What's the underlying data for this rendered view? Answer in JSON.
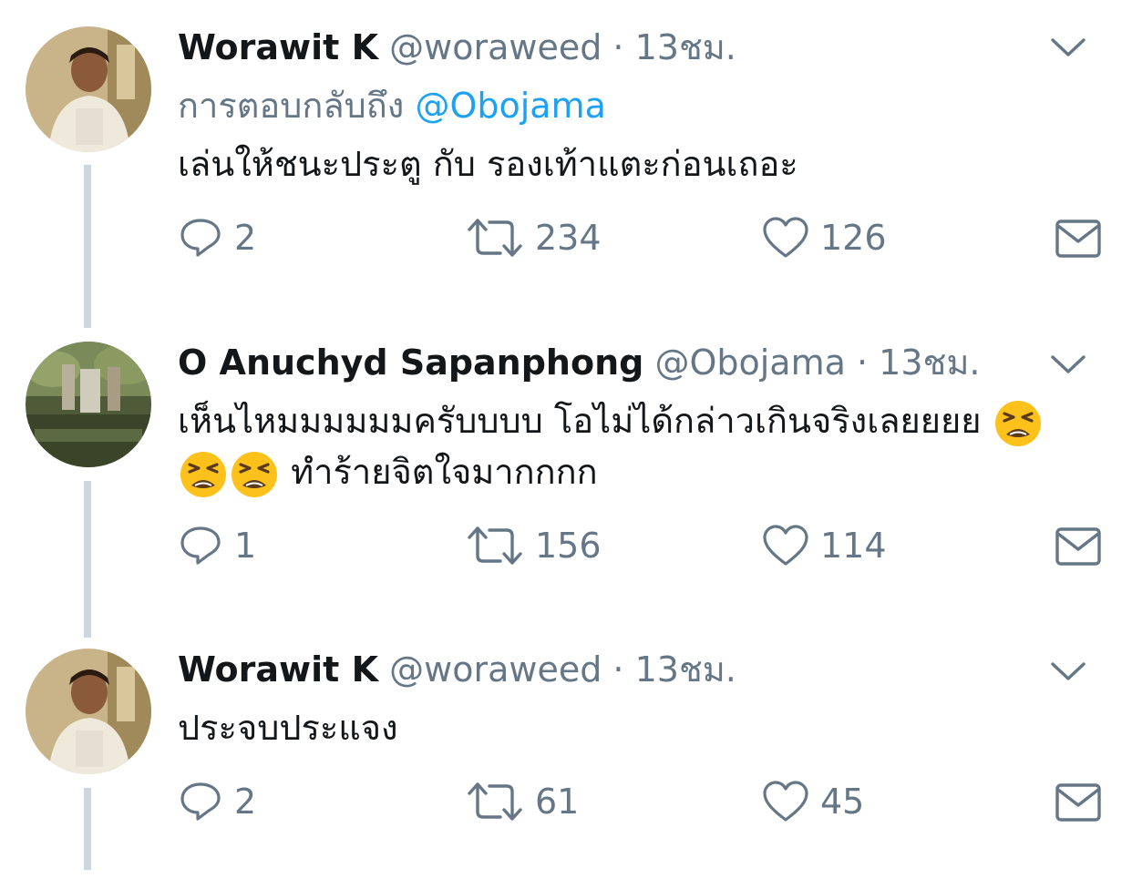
{
  "colors": {
    "text": "#14171a",
    "secondary": "#657786",
    "link": "#1da1f2",
    "thread_line": "#ccd6dd"
  },
  "tweets": [
    {
      "name": "Worawit K",
      "handle": "@woraweed",
      "separator": "·",
      "time": "13ชม.",
      "reply_prefix": "การตอบกลับถึง",
      "reply_to": "@Obojama",
      "text_lines": [
        "เล่นให้ชนะประตู กับ รองเท้าแตะก่อนเถอะ"
      ],
      "replies": "2",
      "retweets": "234",
      "likes": "126",
      "icons": [
        "reply-icon",
        "retweet-icon",
        "like-icon",
        "direct-message-icon",
        "chevron-down-icon"
      ]
    },
    {
      "name": "O Anuchyd Sapanphong",
      "handle": "@Obojama",
      "separator": "·",
      "time": "13ชม.",
      "text_line1": "เห็นไหมมมมมมครับบบบ โอไม่ได้กล่าวเกินจริงเลยยยย",
      "text_line2": "ทำร้ายจิตใจมากกกก",
      "emoji": "tired-face-emoji",
      "replies": "1",
      "retweets": "156",
      "likes": "114"
    },
    {
      "name": "Worawit K",
      "handle": "@woraweed",
      "separator": "·",
      "time": "13ชม.",
      "text_lines": [
        "ประจบประแจง"
      ],
      "replies": "2",
      "retweets": "61",
      "likes": "45"
    }
  ]
}
